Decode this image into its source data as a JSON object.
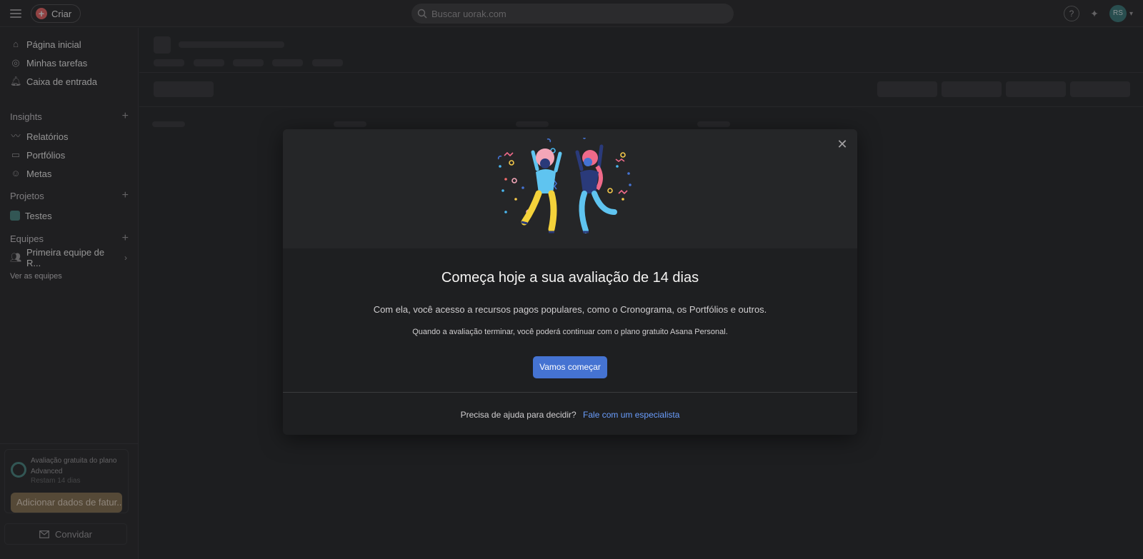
{
  "topbar": {
    "create_label": "Criar",
    "search_placeholder": "Buscar uorak.com",
    "help_label": "?",
    "avatar_initials": "RS"
  },
  "sidebar": {
    "primary": [
      {
        "label": "Página inicial",
        "icon": "home-icon"
      },
      {
        "label": "Minhas tarefas",
        "icon": "check-circle-icon"
      },
      {
        "label": "Caixa de entrada",
        "icon": "bell-icon"
      }
    ],
    "insights_title": "Insights",
    "insights": [
      {
        "label": "Relatórios",
        "icon": "chart-line-icon"
      },
      {
        "label": "Portfólios",
        "icon": "folder-icon"
      },
      {
        "label": "Metas",
        "icon": "person-icon"
      }
    ],
    "projects_title": "Projetos",
    "projects": [
      {
        "label": "Testes",
        "color": "#4f8c87"
      }
    ],
    "teams_title": "Equipes",
    "teams": [
      {
        "label": "Primeira equipe de R..."
      }
    ],
    "see_teams": "Ver as equipes",
    "trial": {
      "line1": "Avaliação gratuita do plano",
      "line2": "Advanced",
      "remaining": "Restam 14 dias",
      "billing_button": "Adicionar dados de fatur..."
    },
    "invite_label": "Convidar"
  },
  "modal": {
    "title": "Começa hoje a sua avaliação de 14 dias",
    "subtitle": "Com ela, você acesso a recursos pagos populares, como o Cronograma, os Portfólios e outros.",
    "note": "Quando a avaliação terminar, você poderá continuar com o plano gratuito Asana Personal.",
    "primary_button": "Vamos começar",
    "footer_text": "Precisa de ajuda para decidir?",
    "footer_link": "Fale com um especialista"
  },
  "colors": {
    "accent": "#4573d2",
    "link": "#6a9dfc",
    "create_plus": "#f06a6a",
    "billing_button": "#8a7555"
  }
}
